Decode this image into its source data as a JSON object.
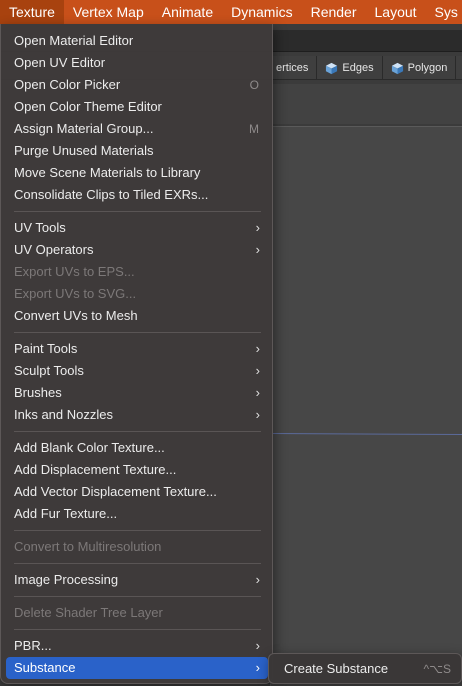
{
  "menubar": {
    "items": [
      "Texture",
      "Vertex Map",
      "Animate",
      "Dynamics",
      "Render",
      "Layout",
      "Sys"
    ],
    "active_index": 0
  },
  "background": {
    "tabs": [
      {
        "label": "ertices",
        "icon": "cube-icon"
      },
      {
        "label": "Edges",
        "icon": "cube-icon"
      },
      {
        "label": "Polygon",
        "icon": "cube-icon"
      }
    ]
  },
  "menu": {
    "groups": [
      [
        {
          "label": "Open Material Editor"
        },
        {
          "label": "Open UV Editor"
        },
        {
          "label": "Open Color Picker",
          "shortcut": "O"
        },
        {
          "label": "Open Color Theme Editor"
        },
        {
          "label": "Assign Material Group...",
          "shortcut": "M"
        },
        {
          "label": "Purge Unused Materials"
        },
        {
          "label": "Move Scene Materials to Library"
        },
        {
          "label": "Consolidate Clips to Tiled EXRs..."
        }
      ],
      [
        {
          "label": "UV Tools",
          "submenu": true
        },
        {
          "label": "UV Operators",
          "submenu": true
        },
        {
          "label": "Export UVs to EPS...",
          "disabled": true
        },
        {
          "label": "Export UVs to SVG...",
          "disabled": true
        },
        {
          "label": "Convert UVs to Mesh"
        }
      ],
      [
        {
          "label": "Paint Tools",
          "submenu": true
        },
        {
          "label": "Sculpt Tools",
          "submenu": true
        },
        {
          "label": "Brushes",
          "submenu": true
        },
        {
          "label": "Inks and Nozzles",
          "submenu": true
        }
      ],
      [
        {
          "label": "Add Blank Color Texture..."
        },
        {
          "label": "Add Displacement Texture..."
        },
        {
          "label": "Add Vector Displacement Texture..."
        },
        {
          "label": "Add Fur Texture..."
        }
      ],
      [
        {
          "label": "Convert to Multiresolution",
          "disabled": true
        }
      ],
      [
        {
          "label": "Image Processing",
          "submenu": true
        }
      ],
      [
        {
          "label": "Delete Shader Tree Layer",
          "disabled": true
        }
      ],
      [
        {
          "label": "PBR...",
          "submenu": true
        },
        {
          "label": "Substance",
          "submenu": true,
          "highlighted": true
        }
      ]
    ]
  },
  "submenu": {
    "label": "Create Substance",
    "shortcut": "^⌥S"
  },
  "colors": {
    "menubar": "#c8501a",
    "highlight": "#2a62c9",
    "menu_bg": "#3e3a3a",
    "disabled_text": "#7c7878"
  },
  "icons": {
    "chevron": "chevron-right-icon"
  }
}
